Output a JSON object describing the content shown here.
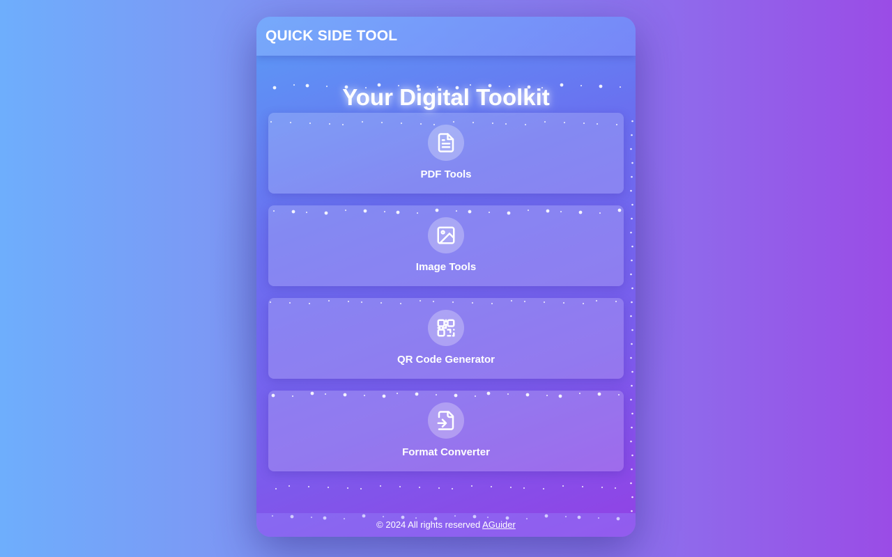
{
  "header": {
    "title": "QUICK SIDE TOOL"
  },
  "hero": {
    "title": "Your Digital Toolkit"
  },
  "tools": [
    {
      "label": "PDF Tools",
      "icon": "file-text-icon"
    },
    {
      "label": "Image Tools",
      "icon": "image-icon"
    },
    {
      "label": "QR Code Generator",
      "icon": "qr-code-icon"
    },
    {
      "label": "Format Converter",
      "icon": "file-convert-icon"
    }
  ],
  "footer": {
    "copyright": "© 2024 All rights reserved",
    "link_text": "AGuider"
  },
  "colors": {
    "background_start": "#6eaefc",
    "background_end": "#9a4ce6",
    "text": "#ffffff"
  }
}
